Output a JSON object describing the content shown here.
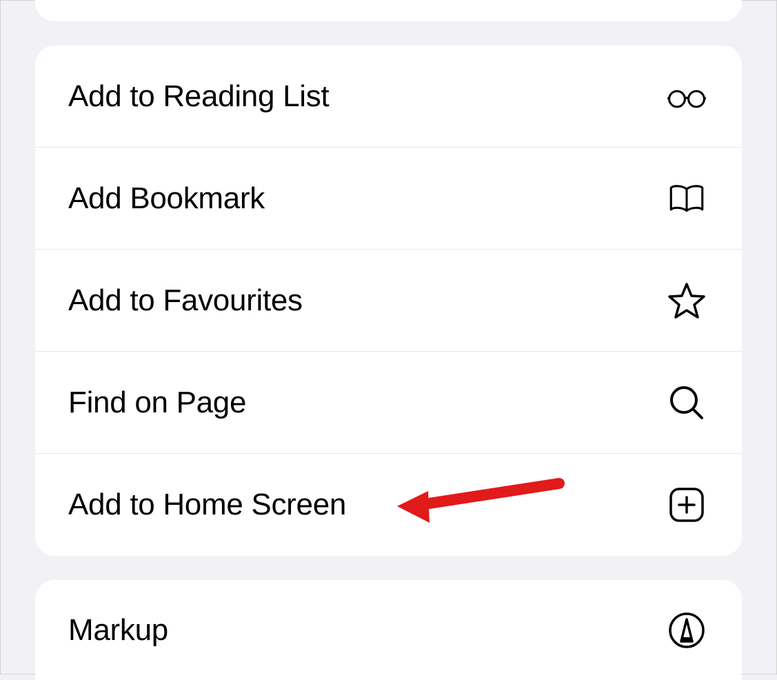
{
  "menu": {
    "group1": [
      {
        "label": "Add to Reading List",
        "icon": "glasses-icon",
        "name": "add-to-reading-list"
      },
      {
        "label": "Add Bookmark",
        "icon": "book-icon",
        "name": "add-bookmark"
      },
      {
        "label": "Add to Favourites",
        "icon": "star-icon",
        "name": "add-to-favourites"
      },
      {
        "label": "Find on Page",
        "icon": "search-icon",
        "name": "find-on-page"
      },
      {
        "label": "Add to Home Screen",
        "icon": "plus-app-icon",
        "name": "add-to-home-screen"
      }
    ],
    "group2": [
      {
        "label": "Markup",
        "icon": "markup-icon",
        "name": "markup"
      }
    ]
  },
  "annotation": {
    "color": "#e11a1a"
  }
}
